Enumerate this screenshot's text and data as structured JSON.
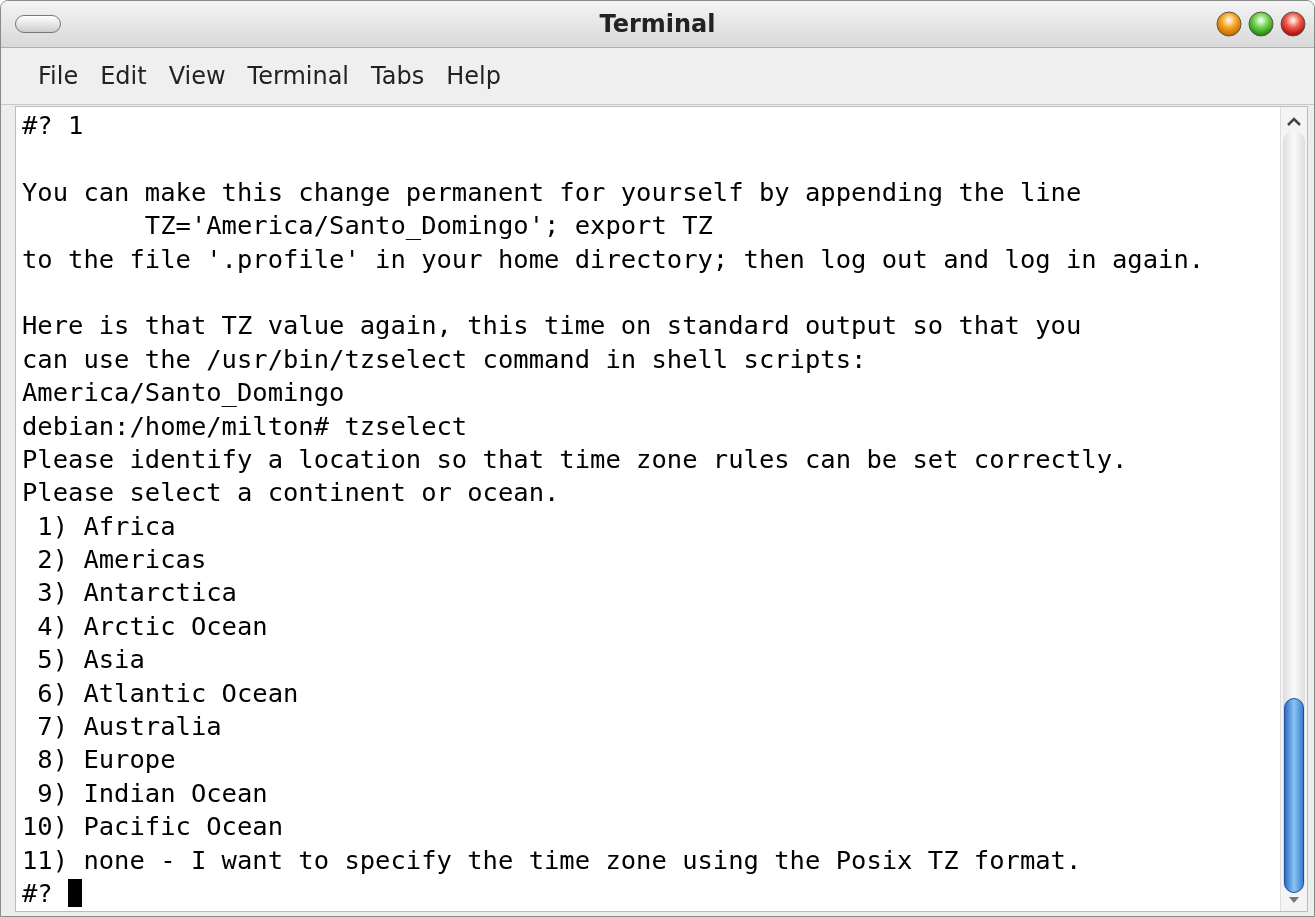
{
  "window": {
    "title": "Terminal"
  },
  "menu": [
    "File",
    "Edit",
    "View",
    "Terminal",
    "Tabs",
    "Help"
  ],
  "terminal": {
    "blocks": [
      [
        "#? 1"
      ],
      [
        "You can make this change permanent for yourself by appending the line",
        "        TZ='America/Santo_Domingo'; export TZ",
        "to the file '.profile' in your home directory; then log out and log in again."
      ],
      [
        "Here is that TZ value again, this time on standard output so that you",
        "can use the /usr/bin/tzselect command in shell scripts:",
        "America/Santo_Domingo",
        "debian:/home/milton# tzselect",
        "Please identify a location so that time zone rules can be set correctly.",
        "Please select a continent or ocean.",
        " 1) Africa",
        " 2) Americas",
        " 3) Antarctica",
        " 4) Arctic Ocean",
        " 5) Asia",
        " 6) Atlantic Ocean",
        " 7) Australia",
        " 8) Europe",
        " 9) Indian Ocean",
        "10) Pacific Ocean",
        "11) none - I want to specify the time zone using the Posix TZ format."
      ]
    ],
    "prompt": "#?"
  }
}
